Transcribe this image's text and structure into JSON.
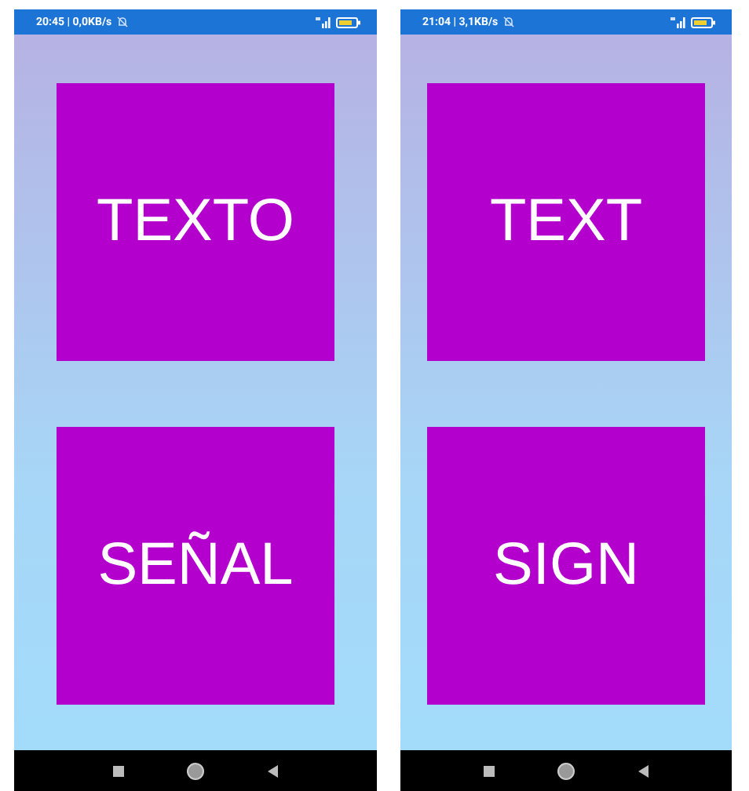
{
  "phones": [
    {
      "status_bar": {
        "text": "20:45 | 0,0KB/s"
      },
      "buttons": [
        {
          "label": "TEXTO"
        },
        {
          "label": "SEÑAL"
        }
      ]
    },
    {
      "status_bar": {
        "text": "21:04 | 3,1KB/s"
      },
      "buttons": [
        {
          "label": "TEXT"
        },
        {
          "label": "SIGN"
        }
      ]
    }
  ]
}
